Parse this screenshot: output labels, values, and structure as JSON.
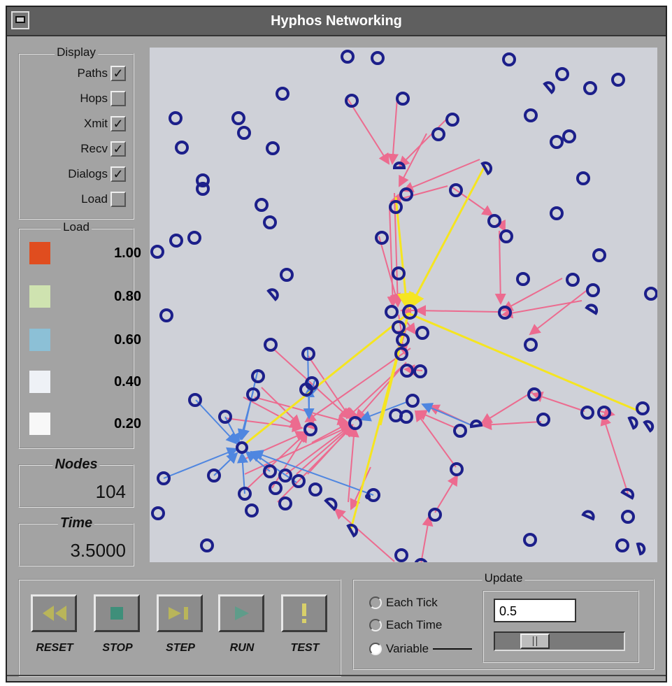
{
  "window": {
    "title": "Hyphos Networking"
  },
  "display": {
    "legend": "Display",
    "items": [
      {
        "label": "Paths",
        "checked": true
      },
      {
        "label": "Hops",
        "checked": false
      },
      {
        "label": "Xmit",
        "checked": true
      },
      {
        "label": "Recv",
        "checked": true
      },
      {
        "label": "Dialogs",
        "checked": true
      },
      {
        "label": "Load",
        "checked": false
      }
    ]
  },
  "load_legend": {
    "legend": "Load",
    "levels": [
      {
        "value": "1.00",
        "color": "#e04d1f"
      },
      {
        "value": "0.80",
        "color": "#cfe3b0"
      },
      {
        "value": "0.60",
        "color": "#8cc0d6"
      },
      {
        "value": "0.40",
        "color": "#eef1f6"
      },
      {
        "value": "0.20",
        "color": "#f8f8f8"
      }
    ]
  },
  "nodes": {
    "label": "Nodes",
    "value": "104"
  },
  "time": {
    "label": "Time",
    "value": "3.5000"
  },
  "controls": {
    "reset_label": "RESET",
    "stop_label": "STOP",
    "step_label": "STEP",
    "run_label": "RUN",
    "test_label": "TEST"
  },
  "update": {
    "legend": "Update",
    "options": [
      {
        "label": "Each Tick",
        "selected": false
      },
      {
        "label": "Each Time",
        "selected": false
      },
      {
        "label": "Variable",
        "selected": true
      }
    ],
    "value": "0.5",
    "slider_level": 0.25
  },
  "colors": {
    "node": "#1c1f8a",
    "path_pink": "#ec6b8f",
    "path_blue": "#4f86e0",
    "path_yellow": "#f5e520"
  }
}
